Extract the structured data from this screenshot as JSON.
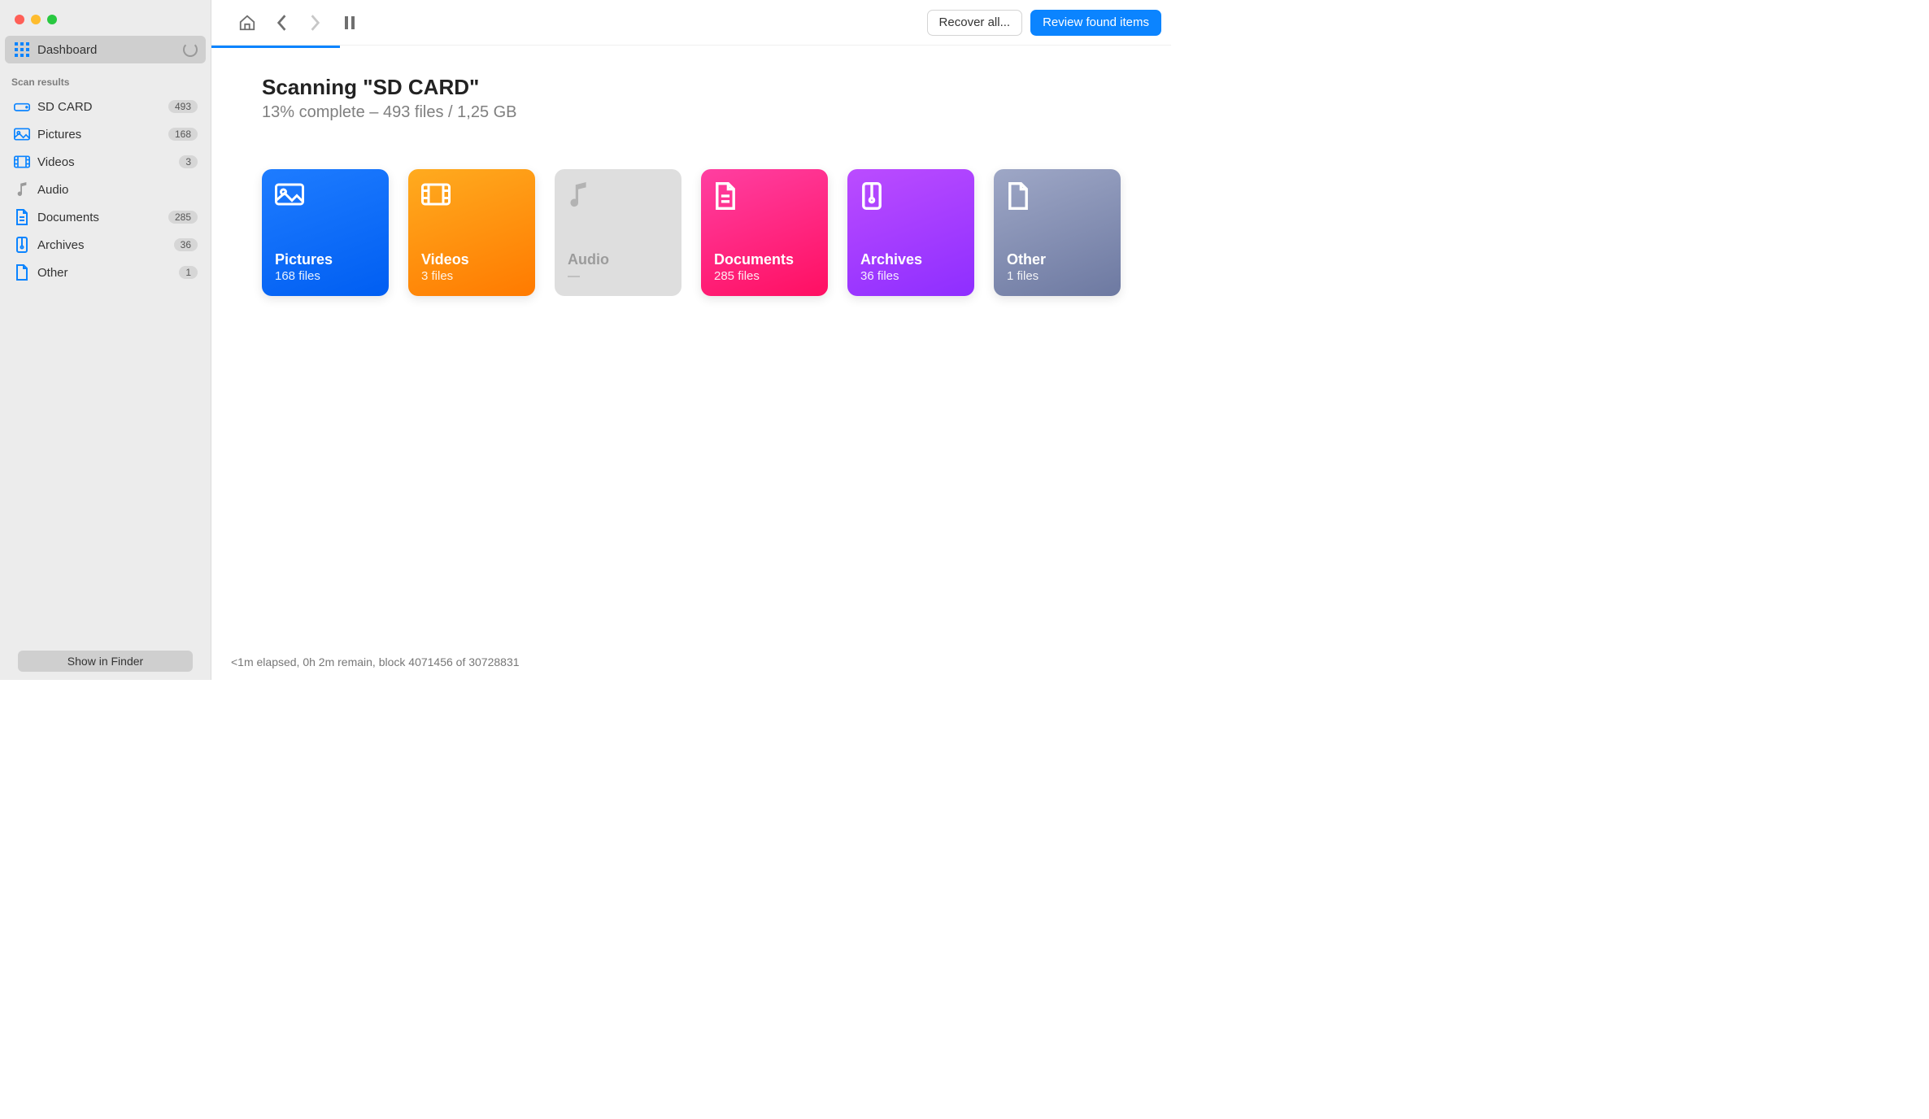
{
  "sidebar": {
    "dashboard_label": "Dashboard",
    "section_label": "Scan results",
    "items": [
      {
        "label": "SD CARD",
        "count": "493",
        "icon": "drive"
      },
      {
        "label": "Pictures",
        "count": "168",
        "icon": "picture"
      },
      {
        "label": "Videos",
        "count": "3",
        "icon": "video"
      },
      {
        "label": "Audio",
        "count": "",
        "icon": "audio"
      },
      {
        "label": "Documents",
        "count": "285",
        "icon": "document"
      },
      {
        "label": "Archives",
        "count": "36",
        "icon": "archive"
      },
      {
        "label": "Other",
        "count": "1",
        "icon": "other"
      }
    ],
    "finder_label": "Show in Finder"
  },
  "toolbar": {
    "recover_all": "Recover all...",
    "review": "Review found items"
  },
  "page": {
    "title": "Scanning \"SD CARD\"",
    "subtitle": "13% complete – 493 files / 1,25 GB"
  },
  "cards": [
    {
      "name": "Pictures",
      "count": "168 files",
      "variant": "pictures",
      "icon": "picture"
    },
    {
      "name": "Videos",
      "count": "3 files",
      "variant": "videos",
      "icon": "video"
    },
    {
      "name": "Audio",
      "count": "—",
      "variant": "audio",
      "icon": "audio",
      "disabled": true
    },
    {
      "name": "Documents",
      "count": "285 files",
      "variant": "documents",
      "icon": "document"
    },
    {
      "name": "Archives",
      "count": "36 files",
      "variant": "archives",
      "icon": "archive"
    },
    {
      "name": "Other",
      "count": "1 files",
      "variant": "other",
      "icon": "other"
    }
  ],
  "status_line": "<1m elapsed, 0h 2m remain, block 4071456 of 30728831"
}
